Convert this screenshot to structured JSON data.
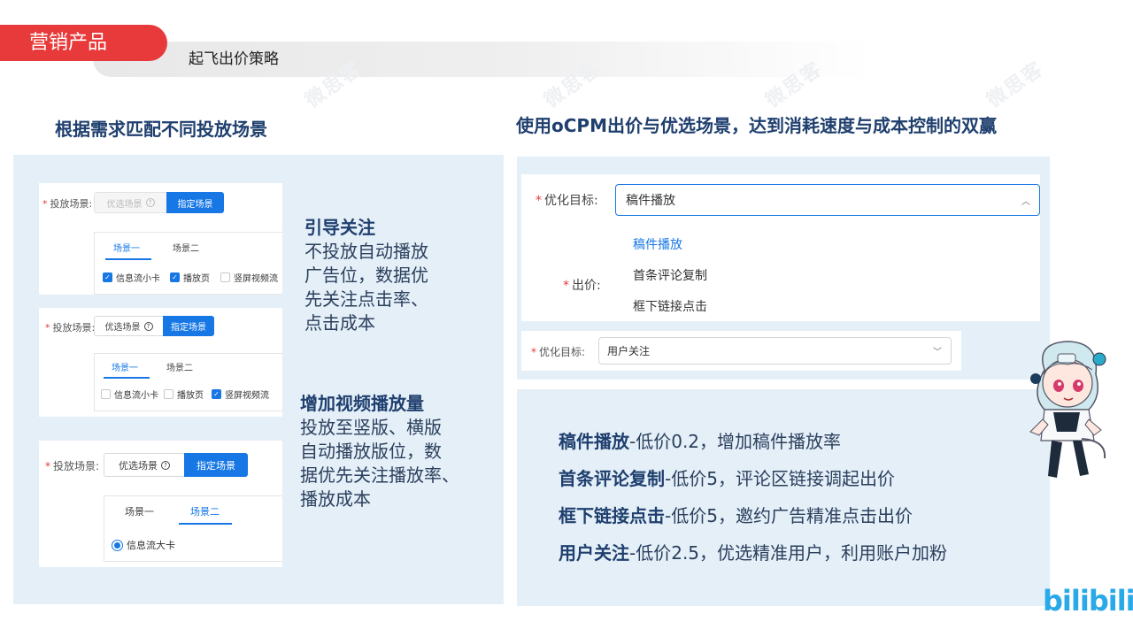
{
  "header": {
    "section_tag": "营销产品",
    "subtitle": "起飞出价策略"
  },
  "watermark_text": "微思客",
  "left": {
    "heading": "根据需求匹配不同投放场景",
    "field_label": "投放场景:",
    "btn_optimized": "优选场景",
    "btn_specified": "指定场景",
    "tab_1": "场景一",
    "tab_2": "场景二",
    "opt_feed_small": "信息流小卡",
    "opt_play_page": "播放页",
    "opt_vertical_stream": "竖屏视频流",
    "opt_vertical_stream_short": "竖屏视频流",
    "opt_feed_large": "信息流大卡",
    "desc1_title": "引导关注",
    "desc1_lines": [
      "不投放自动播放",
      "广告位，数据优",
      "先关注点击率、",
      "点击成本"
    ],
    "desc2_title": "增加视频播放量",
    "desc2_lines": [
      "投放至竖版、横版",
      "自动播放版位，数",
      "据优先关注播放率、",
      "播放成本"
    ]
  },
  "right": {
    "heading": "使用oCPM出价与优选场景，达到消耗速度与成本控制的双赢",
    "target_label": "优化目标:",
    "target_value": "稿件播放",
    "dropdown_options": [
      "稿件播放",
      "首条评论复制",
      "框下链接点击"
    ],
    "bid_label": "出价:",
    "target2_label": "优化目标:",
    "target2_value": "用户关注",
    "bullets": [
      {
        "title": "稿件播放",
        "text": "-低价0.2，增加稿件播放率"
      },
      {
        "title": "首条评论复制",
        "text": "-低价5，评论区链接调起出价"
      },
      {
        "title": "框下链接点击",
        "text": "-低价5，邀约广告精准点击出价"
      },
      {
        "title": "用户关注",
        "text": "-低价2.5，优选精准用户，利用账户加粉"
      }
    ]
  },
  "brand": {
    "logo_text": "bilibili"
  },
  "colors": {
    "accent_red": "#e83a3a",
    "primary_blue": "#1677e5",
    "panel_bg": "#e4eff8",
    "heading_navy": "#1f3f6e",
    "logo_blue": "#2aa9e8"
  }
}
